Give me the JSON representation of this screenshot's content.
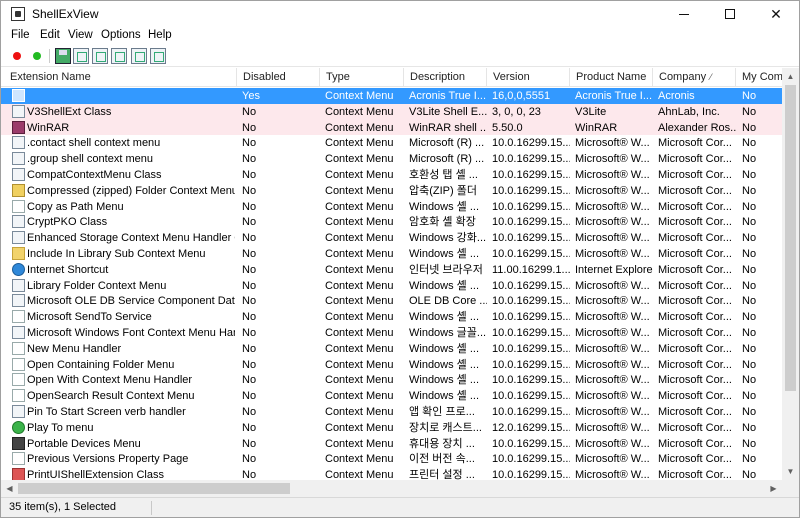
{
  "window": {
    "title": "ShellExView"
  },
  "menu": [
    "File",
    "Edit",
    "View",
    "Options",
    "Help"
  ],
  "toolbar": {
    "icons": [
      "enable-red-dot-icon",
      "enable-green-dot-icon",
      "save-icon",
      "refresh-icon",
      "copy-icon",
      "properties-icon",
      "find-icon",
      "exit-icon"
    ]
  },
  "columns": [
    "Extension Name",
    "Disabled",
    "Type",
    "Description",
    "Version",
    "Product Name",
    "Company",
    "My Com"
  ],
  "sort_column": "Company",
  "rows": [
    {
      "name": "",
      "disabled": "Yes",
      "type": "Context Menu",
      "desc": "Acronis True I...",
      "version": "16,0,0,5551",
      "product": "Acronis True I...",
      "company": "Acronis",
      "mycomp": "No",
      "icon": "generic",
      "state": "selected"
    },
    {
      "name": "V3ShellExt Class",
      "disabled": "No",
      "type": "Context Menu",
      "desc": "V3Lite Shell E...",
      "version": "3, 0, 0, 23",
      "product": "V3Lite",
      "company": "AhnLab, Inc.",
      "mycomp": "No",
      "icon": "generic",
      "state": "pink"
    },
    {
      "name": "WinRAR",
      "disabled": "No",
      "type": "Context Menu",
      "desc": "WinRAR shell ...",
      "version": "5.50.0",
      "product": "WinRAR",
      "company": "Alexander Ros...",
      "mycomp": "No",
      "icon": "rar",
      "state": "pink"
    },
    {
      "name": ".contact shell context menu",
      "disabled": "No",
      "type": "Context Menu",
      "desc": "Microsoft (R) ...",
      "version": "10.0.16299.15...",
      "product": "Microsoft® W...",
      "company": "Microsoft Cor...",
      "mycomp": "No",
      "icon": "generic",
      "state": ""
    },
    {
      "name": ".group shell context menu",
      "disabled": "No",
      "type": "Context Menu",
      "desc": "Microsoft (R) ...",
      "version": "10.0.16299.15...",
      "product": "Microsoft® W...",
      "company": "Microsoft Cor...",
      "mycomp": "No",
      "icon": "generic",
      "state": ""
    },
    {
      "name": "CompatContextMenu Class",
      "disabled": "No",
      "type": "Context Menu",
      "desc": "호환성 탭 셸 ...",
      "version": "10.0.16299.15...",
      "product": "Microsoft® W...",
      "company": "Microsoft Cor...",
      "mycomp": "No",
      "icon": "generic",
      "state": ""
    },
    {
      "name": "Compressed (zipped) Folder Context Menu",
      "disabled": "No",
      "type": "Context Menu",
      "desc": "압축(ZIP) 폴더",
      "version": "10.0.16299.15...",
      "product": "Microsoft® W...",
      "company": "Microsoft Cor...",
      "mycomp": "No",
      "icon": "zip",
      "state": ""
    },
    {
      "name": "Copy as Path Menu",
      "disabled": "No",
      "type": "Context Menu",
      "desc": "Windows 셸 ...",
      "version": "10.0.16299.15...",
      "product": "Microsoft® W...",
      "company": "Microsoft Cor...",
      "mycomp": "No",
      "icon": "blank",
      "state": ""
    },
    {
      "name": "CryptPKO Class",
      "disabled": "No",
      "type": "Context Menu",
      "desc": "암호화 셸 확장",
      "version": "10.0.16299.15...",
      "product": "Microsoft® W...",
      "company": "Microsoft Cor...",
      "mycomp": "No",
      "icon": "generic",
      "state": ""
    },
    {
      "name": "Enhanced Storage Context Menu Handler Cl...",
      "disabled": "No",
      "type": "Context Menu",
      "desc": "Windows 강화...",
      "version": "10.0.16299.15...",
      "product": "Microsoft® W...",
      "company": "Microsoft Cor...",
      "mycomp": "No",
      "icon": "generic",
      "state": ""
    },
    {
      "name": "Include In Library Sub Context Menu",
      "disabled": "No",
      "type": "Context Menu",
      "desc": "Windows 셸 ...",
      "version": "10.0.16299.15...",
      "product": "Microsoft® W...",
      "company": "Microsoft Cor...",
      "mycomp": "No",
      "icon": "folder",
      "state": ""
    },
    {
      "name": "Internet Shortcut",
      "disabled": "No",
      "type": "Context Menu",
      "desc": "인터넷 브라우저",
      "version": "11.00.16299.1...",
      "product": "Internet Explorer",
      "company": "Microsoft Cor...",
      "mycomp": "No",
      "icon": "globe",
      "state": ""
    },
    {
      "name": "Library Folder Context Menu",
      "disabled": "No",
      "type": "Context Menu",
      "desc": "Windows 셸 ...",
      "version": "10.0.16299.15...",
      "product": "Microsoft® W...",
      "company": "Microsoft Cor...",
      "mycomp": "No",
      "icon": "generic",
      "state": ""
    },
    {
      "name": "Microsoft OLE DB Service Component Data ...",
      "disabled": "No",
      "type": "Context Menu",
      "desc": "OLE DB Core ...",
      "version": "10.0.16299.15...",
      "product": "Microsoft® W...",
      "company": "Microsoft Cor...",
      "mycomp": "No",
      "icon": "generic",
      "state": ""
    },
    {
      "name": "Microsoft SendTo Service",
      "disabled": "No",
      "type": "Context Menu",
      "desc": "Windows 셸 ...",
      "version": "10.0.16299.15...",
      "product": "Microsoft® W...",
      "company": "Microsoft Cor...",
      "mycomp": "No",
      "icon": "blank",
      "state": ""
    },
    {
      "name": "Microsoft Windows Font Context Menu Han...",
      "disabled": "No",
      "type": "Context Menu",
      "desc": "Windows 글꼴...",
      "version": "10.0.16299.15...",
      "product": "Microsoft® W...",
      "company": "Microsoft Cor...",
      "mycomp": "No",
      "icon": "generic",
      "state": ""
    },
    {
      "name": "New Menu Handler",
      "disabled": "No",
      "type": "Context Menu",
      "desc": "Windows 셸 ...",
      "version": "10.0.16299.15...",
      "product": "Microsoft® W...",
      "company": "Microsoft Cor...",
      "mycomp": "No",
      "icon": "blank",
      "state": ""
    },
    {
      "name": "Open Containing Folder Menu",
      "disabled": "No",
      "type": "Context Menu",
      "desc": "Windows 셸 ...",
      "version": "10.0.16299.15...",
      "product": "Microsoft® W...",
      "company": "Microsoft Cor...",
      "mycomp": "No",
      "icon": "blank",
      "state": ""
    },
    {
      "name": "Open With Context Menu Handler",
      "disabled": "No",
      "type": "Context Menu",
      "desc": "Windows 셸 ...",
      "version": "10.0.16299.15...",
      "product": "Microsoft® W...",
      "company": "Microsoft Cor...",
      "mycomp": "No",
      "icon": "blank",
      "state": ""
    },
    {
      "name": "OpenSearch Result Context Menu",
      "disabled": "No",
      "type": "Context Menu",
      "desc": "Windows 셸 ...",
      "version": "10.0.16299.15...",
      "product": "Microsoft® W...",
      "company": "Microsoft Cor...",
      "mycomp": "No",
      "icon": "blank",
      "state": ""
    },
    {
      "name": "Pin To Start Screen verb handler",
      "disabled": "No",
      "type": "Context Menu",
      "desc": "앱 확인 프로...",
      "version": "10.0.16299.15...",
      "product": "Microsoft® W...",
      "company": "Microsoft Cor...",
      "mycomp": "No",
      "icon": "generic",
      "state": ""
    },
    {
      "name": "Play To menu",
      "disabled": "No",
      "type": "Context Menu",
      "desc": "장치로 캐스트...",
      "version": "12.0.16299.15...",
      "product": "Microsoft® W...",
      "company": "Microsoft Cor...",
      "mycomp": "No",
      "icon": "play",
      "state": ""
    },
    {
      "name": "Portable Devices Menu",
      "disabled": "No",
      "type": "Context Menu",
      "desc": "휴대용 장치 ...",
      "version": "10.0.16299.15...",
      "product": "Microsoft® W...",
      "company": "Microsoft Cor...",
      "mycomp": "No",
      "icon": "devices",
      "state": ""
    },
    {
      "name": "Previous Versions Property Page",
      "disabled": "No",
      "type": "Context Menu",
      "desc": "이전 버전 속...",
      "version": "10.0.16299.15...",
      "product": "Microsoft® W...",
      "company": "Microsoft Cor...",
      "mycomp": "No",
      "icon": "blank",
      "state": ""
    },
    {
      "name": "PrintUIShellExtension Class",
      "disabled": "No",
      "type": "Context Menu",
      "desc": "프린터 설정 ...",
      "version": "10.0.16299.15...",
      "product": "Microsoft® W...",
      "company": "Microsoft Cor...",
      "mycomp": "No",
      "icon": "printer",
      "state": ""
    }
  ],
  "status": {
    "text": "35 item(s), 1 Selected"
  },
  "colors": {
    "selection": "#3399ff",
    "highlight_row": "#fde8ec"
  }
}
